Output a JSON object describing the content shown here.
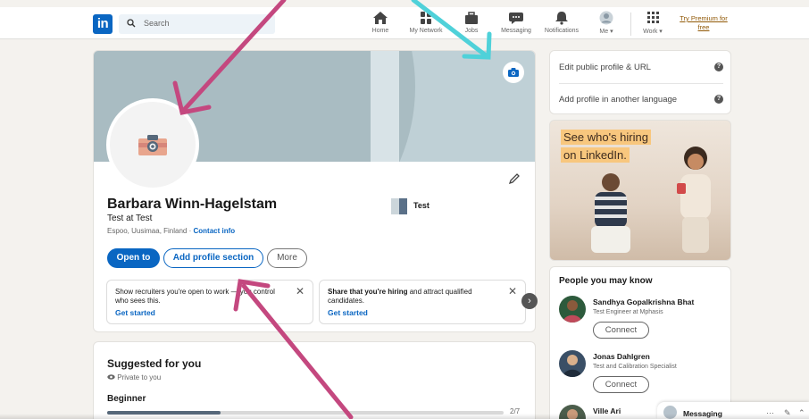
{
  "header": {
    "logo": "in",
    "search_placeholder": "Search",
    "nav": [
      {
        "label": "Home",
        "icon": "home-icon"
      },
      {
        "label": "My Network",
        "icon": "network-icon"
      },
      {
        "label": "Jobs",
        "icon": "jobs-icon"
      },
      {
        "label": "Messaging",
        "icon": "messaging-icon"
      },
      {
        "label": "Notifications",
        "icon": "bell-icon"
      },
      {
        "label": "Me ▾",
        "icon": "avatar"
      },
      {
        "label": "Work ▾",
        "icon": "grid-icon"
      }
    ],
    "premium_line1": "Try Premium for",
    "premium_line2": "free"
  },
  "profile": {
    "name": "Barbara Winn-Hagelstam",
    "headline": "Test at Test",
    "location": "Espoo, Uusimaa, Finland · ",
    "contact_info": "Contact info",
    "company": "Test",
    "buttons": {
      "open_to": "Open to",
      "add_section": "Add profile section",
      "more": "More"
    },
    "suggestions": [
      {
        "text": "Show recruiters you're open to work — you control who sees this.",
        "link": "Get started"
      },
      {
        "text_bold": "Share that you're hiring",
        "text": " and attract qualified candidates.",
        "link": "Get started"
      }
    ]
  },
  "suggested": {
    "title": "Suggested for you",
    "privacy": "Private to you",
    "level": "Beginner",
    "progress_fraction": 0.2857,
    "progress_label": "2/7"
  },
  "sidebar": {
    "links": [
      "Edit public profile & URL",
      "Add profile in another language"
    ],
    "ad_lines": [
      "See who's hiring",
      "on LinkedIn."
    ],
    "pymk_title": "People you may know",
    "people": [
      {
        "name": "Sandhya Gopalkrishna Bhat",
        "title": "Test Engineer at Mphasis",
        "action": "Connect"
      },
      {
        "name": "Jonas Dahlgren",
        "title": "Test and Calibration Specialist",
        "action": "Connect"
      },
      {
        "name": "Ville Ari",
        "title": "",
        "action": ""
      }
    ]
  },
  "messaging": {
    "label": "Messaging"
  },
  "colors": {
    "brand": "#0a66c2",
    "annotation_pink": "#c4487f",
    "annotation_cyan": "#4fd1d9"
  }
}
